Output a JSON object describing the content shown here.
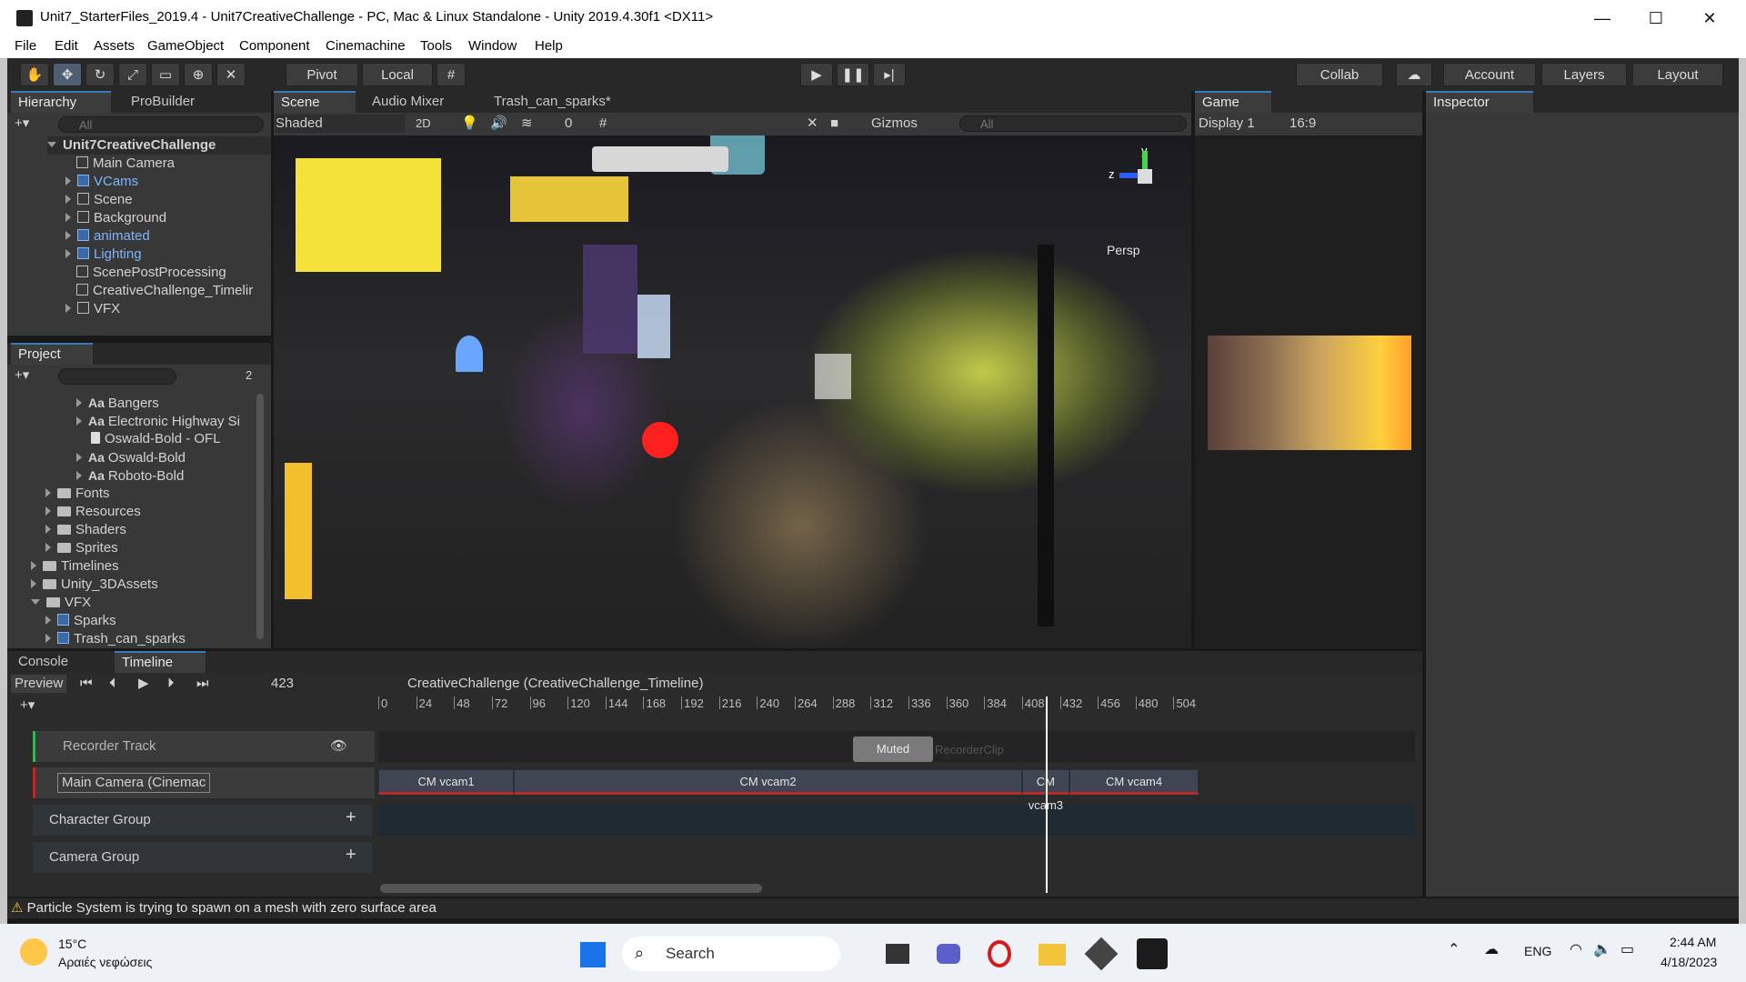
{
  "window": {
    "title": "Unit7_StarterFiles_2019.4 - Unit7CreativeChallenge - PC, Mac & Linux Standalone - Unity 2019.4.30f1 <DX11>",
    "minimize": "—",
    "maximize": "☐",
    "close": "✕"
  },
  "menu": [
    "File",
    "Edit",
    "Assets",
    "GameObject",
    "Component",
    "Cinemachine",
    "Tools",
    "Window",
    "Help"
  ],
  "toolbar": {
    "pivot": "Pivot",
    "local": "Local",
    "collab": "Collab",
    "account": "Account",
    "layers": "Layers",
    "layout": "Layout"
  },
  "hierarchy": {
    "tabs": [
      "Hierarchy",
      "ProBuilder"
    ],
    "search_placeholder": "All",
    "scene_name": "Unit7CreativeChallenge",
    "items": [
      {
        "label": "Main Camera",
        "prefab": false
      },
      {
        "label": "VCams",
        "prefab": true
      },
      {
        "label": "Scene",
        "prefab": false
      },
      {
        "label": "Background",
        "prefab": false
      },
      {
        "label": "animated",
        "prefab": true
      },
      {
        "label": "Lighting",
        "prefab": true
      },
      {
        "label": "ScenePostProcessing",
        "prefab": false
      },
      {
        "label": "CreativeChallenge_Timelir",
        "prefab": false
      },
      {
        "label": "VFX",
        "prefab": false
      }
    ]
  },
  "scene_tabs": {
    "scene": "Scene",
    "audio_mixer": "Audio Mixer",
    "trash": "Trash_can_sparks*",
    "shading": "Shaded",
    "mode_2d": "2D",
    "hidden_count": "0",
    "gizmos": "Gizmos",
    "search_placeholder": "All",
    "persp": "Persp",
    "axis_y": "y",
    "axis_z": "z"
  },
  "game": {
    "tab": "Game",
    "display": "Display 1",
    "aspect": "16:9"
  },
  "inspector": {
    "tab": "Inspector"
  },
  "project": {
    "tab": "Project",
    "hidden_count": "2",
    "items": [
      {
        "label": "Bangers",
        "type": "font",
        "indent": 2
      },
      {
        "label": "Electronic Highway Si",
        "type": "font",
        "indent": 2
      },
      {
        "label": "Oswald-Bold - OFL",
        "type": "file",
        "indent": 2
      },
      {
        "label": "Oswald-Bold",
        "type": "font",
        "indent": 2
      },
      {
        "label": "Roboto-Bold",
        "type": "font",
        "indent": 2
      },
      {
        "label": "Fonts",
        "type": "folder",
        "indent": 1
      },
      {
        "label": "Resources",
        "type": "folder",
        "indent": 1
      },
      {
        "label": "Shaders",
        "type": "folder",
        "indent": 1
      },
      {
        "label": "Sprites",
        "type": "folder",
        "indent": 1
      },
      {
        "label": "Timelines",
        "type": "folder",
        "indent": 0
      },
      {
        "label": "Unity_3DAssets",
        "type": "folder",
        "indent": 0
      },
      {
        "label": "VFX",
        "type": "folder-open",
        "indent": 0
      },
      {
        "label": "Sparks",
        "type": "prefab",
        "indent": 1
      },
      {
        "label": "Trash_can_sparks",
        "type": "prefab",
        "indent": 1
      }
    ]
  },
  "timeline": {
    "tabs": [
      "Console",
      "Timeline"
    ],
    "preview": "Preview",
    "frame": "423",
    "asset": "CreativeChallenge (CreativeChallenge_Timeline)",
    "ruler": [
      "0",
      "24",
      "48",
      "72",
      "96",
      "120",
      "144",
      "168",
      "192",
      "216",
      "240",
      "264",
      "288",
      "312",
      "336",
      "360",
      "384",
      "408",
      "432",
      "456",
      "480",
      "504"
    ],
    "playhead_frame": 423,
    "tracks": [
      {
        "label": "Recorder Track"
      },
      {
        "label": "Main Camera (Cinemac"
      },
      {
        "label": "Character Group"
      },
      {
        "label": "Camera Group"
      }
    ],
    "muted_label": "Muted",
    "recorder_clip": "RecorderClip",
    "clips": [
      {
        "label": "CM vcam1",
        "start": 0,
        "end": 86
      },
      {
        "label": "CM vcam2",
        "start": 86,
        "end": 408
      },
      {
        "label": "CM vcam3",
        "start": 408,
        "end": 438
      },
      {
        "label": "CM vcam4",
        "start": 438,
        "end": 520
      }
    ]
  },
  "status": {
    "message": "Particle System is trying to spawn on a mesh with zero surface area"
  },
  "taskbar": {
    "weather_temp": "15°C",
    "weather_desc": "Αραιές νεφώσεις",
    "search": "Search",
    "lang": "ENG",
    "time": "2:44 AM",
    "date": "4/18/2023"
  }
}
